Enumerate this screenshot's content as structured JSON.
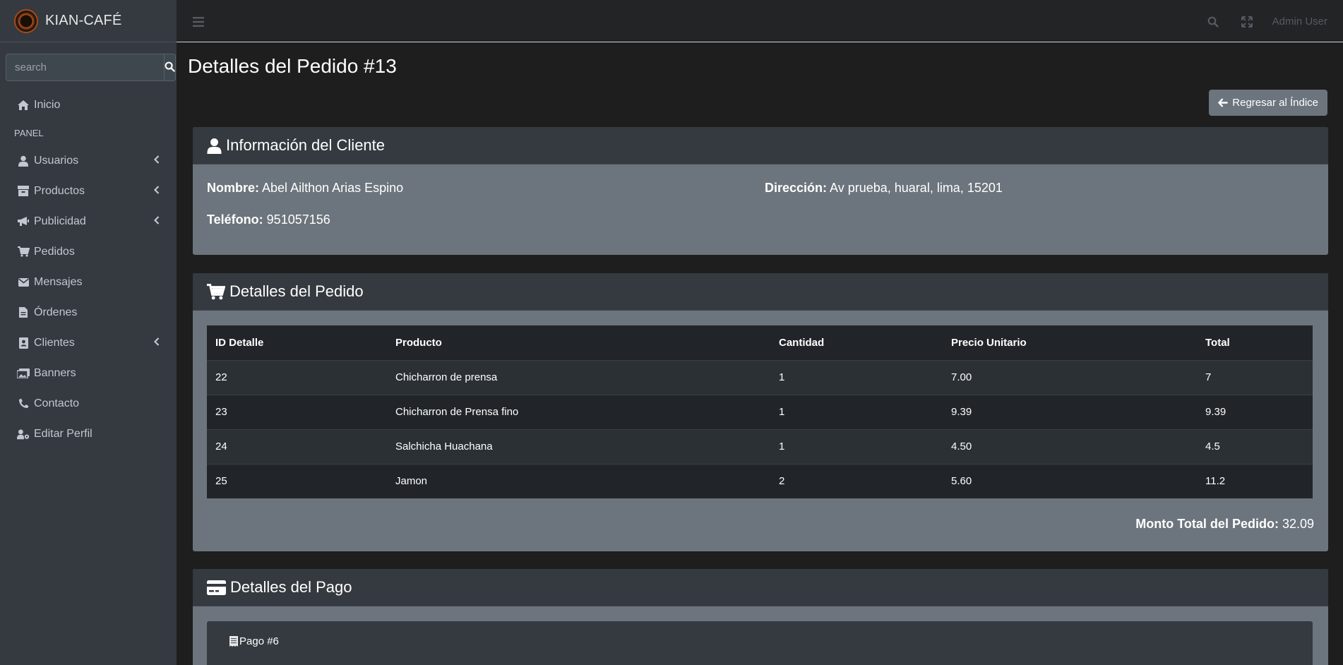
{
  "brand": {
    "name": "KIAN-CAFÉ"
  },
  "search": {
    "placeholder": "search"
  },
  "sidebar": {
    "items": [
      {
        "label": "Inicio",
        "icon": "home-icon"
      },
      {
        "label": "PANEL",
        "header": true
      },
      {
        "label": "Usuarios",
        "icon": "user-icon",
        "expandable": true
      },
      {
        "label": "Productos",
        "icon": "box-icon",
        "expandable": true
      },
      {
        "label": "Publicidad",
        "icon": "megaphone-icon",
        "expandable": true
      },
      {
        "label": "Pedidos",
        "icon": "cart-icon"
      },
      {
        "label": "Mensajes",
        "icon": "envelope-icon"
      },
      {
        "label": "Órdenes",
        "icon": "file-icon"
      },
      {
        "label": "Clientes",
        "icon": "contact-card-icon",
        "expandable": true
      },
      {
        "label": "Banners",
        "icon": "images-icon"
      },
      {
        "label": "Contacto",
        "icon": "phone-icon"
      },
      {
        "label": "Editar Perfil",
        "icon": "user-gear-icon"
      }
    ]
  },
  "topbar": {
    "user": "Admin User"
  },
  "page": {
    "title": "Detalles del Pedido #13",
    "back_label": "Regresar al Índice"
  },
  "client": {
    "header": "Información del Cliente",
    "name_label": "Nombre:",
    "name": "Abel Ailthon Arias Espino",
    "address_label": "Dirección:",
    "address": "Av prueba, huaral, lima, 15201",
    "phone_label": "Teléfono:",
    "phone": "951057156"
  },
  "order": {
    "header": "Detalles del Pedido",
    "columns": [
      "ID Detalle",
      "Producto",
      "Cantidad",
      "Precio Unitario",
      "Total"
    ],
    "rows": [
      [
        "22",
        "Chicharron de prensa",
        "1",
        "7.00",
        "7"
      ],
      [
        "23",
        "Chicharron de Prensa fino",
        "1",
        "9.39",
        "9.39"
      ],
      [
        "24",
        "Salchicha Huachana",
        "1",
        "4.50",
        "4.5"
      ],
      [
        "25",
        "Jamon",
        "2",
        "5.60",
        "11.2"
      ]
    ],
    "total_label": "Monto Total del Pedido:",
    "total": "32.09"
  },
  "payment": {
    "header": "Detalles del Pago",
    "item": "Pago #6"
  },
  "colors": {
    "sidebar": "#343a40",
    "card_body": "#6c757d",
    "table_bg": "#212529",
    "content_bg": "#1e1e1e"
  }
}
